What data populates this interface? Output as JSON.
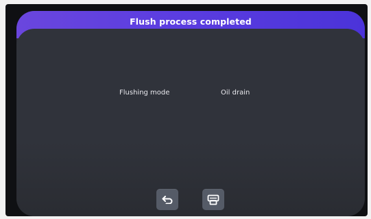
{
  "dialog": {
    "title": "Flush process completed",
    "fields": [
      {
        "label": "Flushing mode",
        "value": "Oil drain"
      }
    ]
  },
  "actions": {
    "back_icon": "return-arrow-icon",
    "print_icon": "printer-icon"
  },
  "colors": {
    "title_bar_accent": "#5b3de0",
    "panel_background": "#30333b",
    "button_background": "#555b67",
    "text": "#e9e9ee"
  }
}
